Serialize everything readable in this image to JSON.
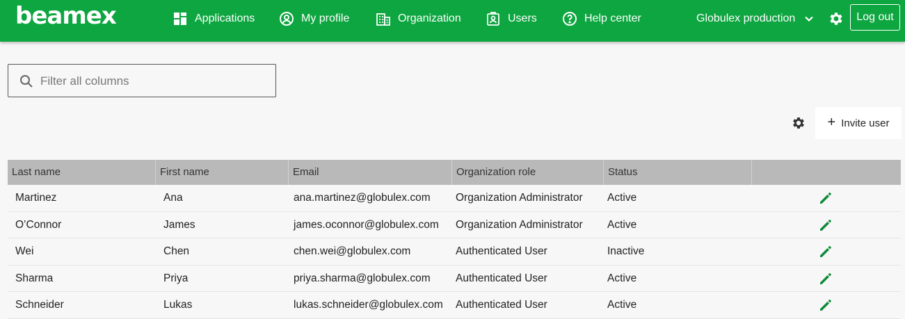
{
  "header": {
    "logo": "beamex",
    "nav": [
      {
        "label": "Applications",
        "icon": "grid-icon"
      },
      {
        "label": "My profile",
        "icon": "user-circle-icon"
      },
      {
        "label": "Organization",
        "icon": "building-icon"
      },
      {
        "label": "Users",
        "icon": "badge-icon"
      },
      {
        "label": "Help center",
        "icon": "help-circle-icon"
      }
    ],
    "environment": "Globulex production",
    "logout_label": "Log out"
  },
  "colors": {
    "brand": "#0ea640",
    "edit_icon": "#0e8a3a",
    "header_row": "#b9b9b9"
  },
  "search": {
    "placeholder": "Filter all columns",
    "value": ""
  },
  "toolbar": {
    "invite_label": "Invite user"
  },
  "table": {
    "columns": [
      "Last name",
      "First name",
      "Email",
      "Organization role",
      "Status",
      ""
    ],
    "rows": [
      {
        "last": "Martinez",
        "first": "Ana",
        "email": "ana.martinez@globulex.com",
        "role": "Organization Administrator",
        "status": "Active"
      },
      {
        "last": "O’Connor",
        "first": "James",
        "email": "james.oconnor@globulex.com",
        "role": "Organization Administrator",
        "status": "Active"
      },
      {
        "last": "Wei",
        "first": "Chen",
        "email": "chen.wei@globulex.com",
        "role": "Authenticated User",
        "status": "Inactive"
      },
      {
        "last": "Sharma",
        "first": "Priya",
        "email": "priya.sharma@globulex.com",
        "role": "Authenticated User",
        "status": "Active"
      },
      {
        "last": "Schneider",
        "first": "Lukas",
        "email": "lukas.schneider@globulex.com",
        "role": "Authenticated User",
        "status": "Active"
      }
    ]
  }
}
